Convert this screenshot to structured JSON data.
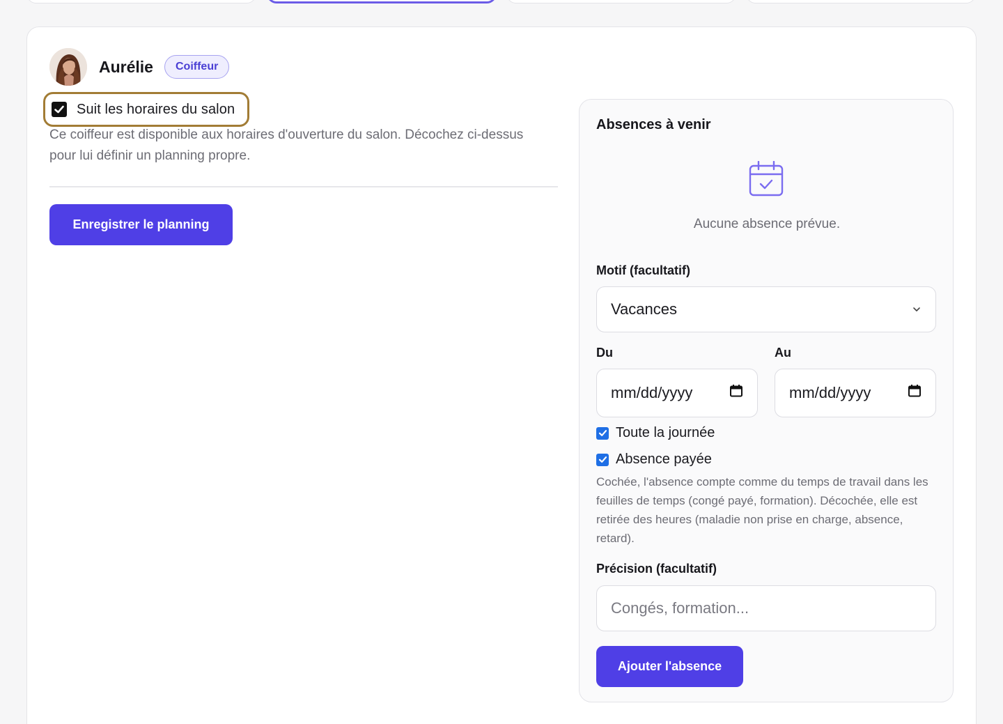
{
  "staff": {
    "name": "Aurélie",
    "role": "Coiffeur"
  },
  "schedule": {
    "follow_salon_label": "Suit les horaires du salon",
    "follow_salon_checked": true,
    "help_text": "Ce coiffeur est disponible aux horaires d'ouverture du salon. Décochez ci-dessus pour lui définir un planning propre.",
    "save_label": "Enregistrer le planning"
  },
  "absences": {
    "title": "Absences à venir",
    "empty_text": "Aucune absence prévue.",
    "motif_label": "Motif (facultatif)",
    "motif_value": "Vacances",
    "from_label": "Du",
    "from_placeholder": "mm/dd/yyyy",
    "to_label": "Au",
    "to_placeholder": "mm/dd/yyyy",
    "all_day_label": "Toute la journée",
    "all_day_checked": true,
    "paid_label": "Absence payée",
    "paid_checked": true,
    "paid_help": "Cochée, l'absence compte comme du temps de travail dans les feuilles de temps (congé payé, formation). Décochée, elle est retirée des heures (maladie non prise en charge, absence, retard).",
    "precision_label": "Précision (facultatif)",
    "precision_placeholder": "Congés, formation...",
    "add_label": "Ajouter l'absence"
  },
  "colors": {
    "accent": "#4f3fe6",
    "checkbox_blue": "#1f6fe5",
    "focus_ring": "#a27c35"
  }
}
